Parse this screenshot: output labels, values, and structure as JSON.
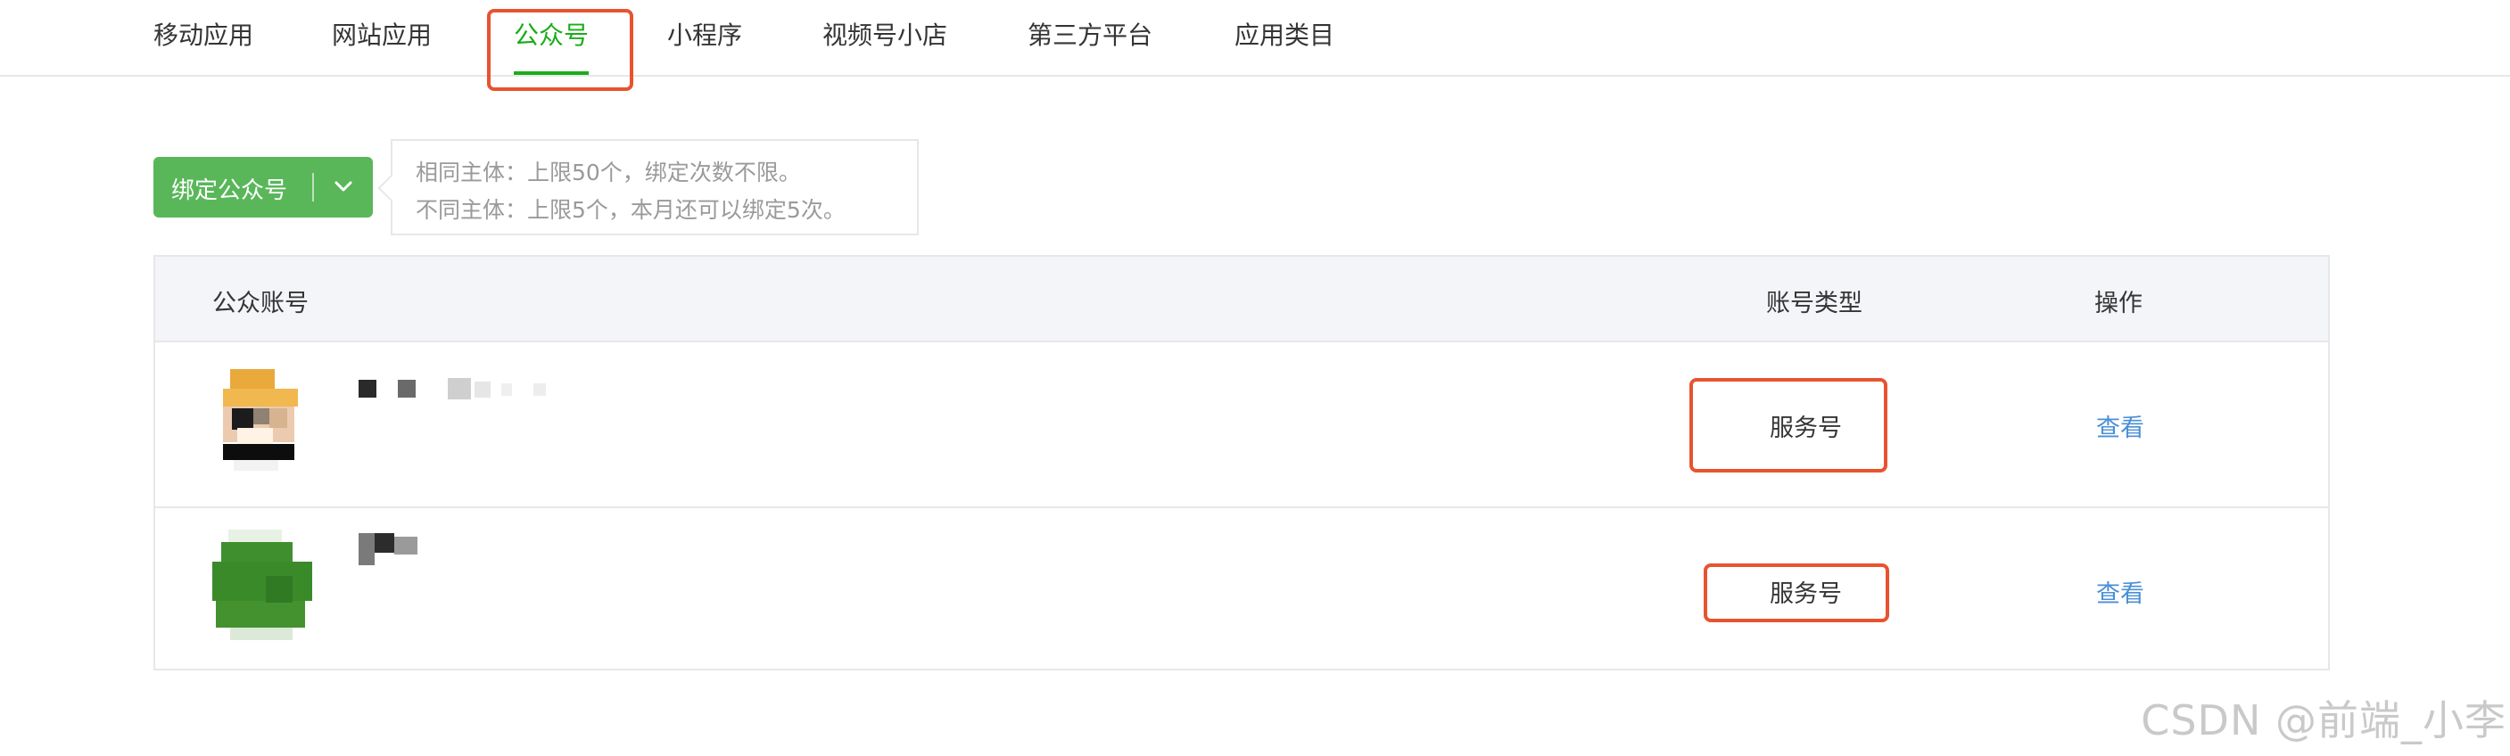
{
  "tabs": [
    {
      "label": "移动应用"
    },
    {
      "label": "网站应用"
    },
    {
      "label": "公众号",
      "active": true
    },
    {
      "label": "小程序"
    },
    {
      "label": "视频号小店"
    },
    {
      "label": "第三方平台"
    },
    {
      "label": "应用类目"
    }
  ],
  "bind_button": {
    "label": "绑定公众号",
    "icon": "chevron-down-icon"
  },
  "tip": {
    "line1": "相同主体：上限50个，绑定次数不限。",
    "line2": "不同主体：上限5个，本月还可以绑定5次。"
  },
  "table": {
    "headers": {
      "account": "公众账号",
      "type": "账号类型",
      "action": "操作"
    },
    "rows": [
      {
        "type": "服务号",
        "action": "查看"
      },
      {
        "type": "服务号",
        "action": "查看"
      }
    ]
  },
  "watermark": "CSDN @前端_小李",
  "colors": {
    "accent": "#1aad19",
    "button": "#59b75a",
    "highlight": "#e8532f",
    "link": "#4a8fd6"
  }
}
